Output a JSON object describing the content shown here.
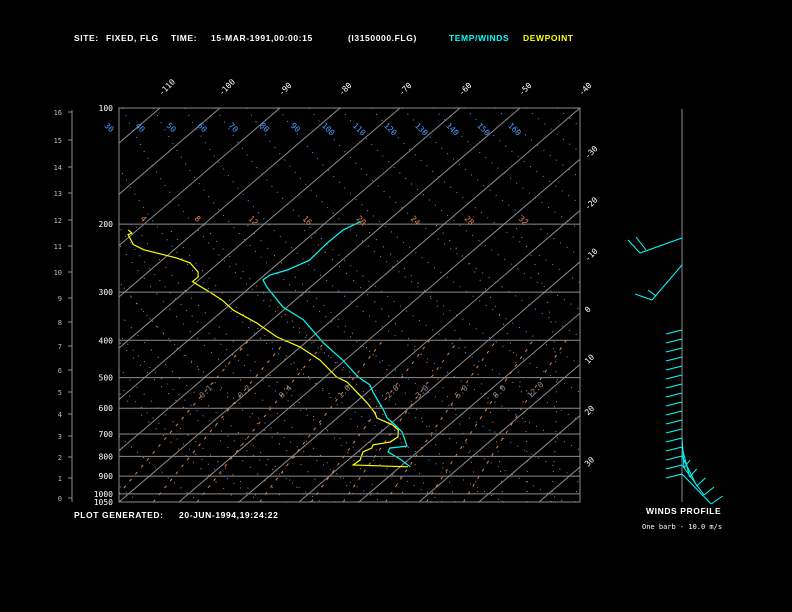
{
  "header": {
    "site_label": "SITE:",
    "site_value": "FIXED, FLG",
    "time_label": "TIME:",
    "time_value": "15-MAR-1991,00:00:15",
    "file": "(I3150000.FLG)",
    "legend_temp": "TEMP/WINDS",
    "legend_dewpoint": "DEWPOINT"
  },
  "footer": {
    "generated_label": "PLOT GENERATED:",
    "generated_value": "20-JUN-1994,19:24:22"
  },
  "winds": {
    "title": "WINDS PROFILE",
    "note": "One barb - 10.0 m/s"
  },
  "colors": {
    "temp": "#00ffff",
    "dewpoint": "#ffff00",
    "dry_adiabat": "#4a9cff",
    "moist": "#e8804a",
    "isotherm": "#8c8c8c",
    "text": "#ffffff"
  },
  "chart_data": {
    "type": "line",
    "subtype": "skew-T log-p",
    "y_scale": "log",
    "ylim_hpa": [
      1050,
      100
    ],
    "pressure_ticks": [
      100,
      200,
      300,
      400,
      500,
      600,
      700,
      800,
      900,
      1000,
      1050
    ],
    "height_ticks_km": [
      16,
      15,
      14,
      13,
      12,
      11,
      10,
      9,
      8,
      7,
      6,
      5,
      4,
      3,
      2,
      1,
      0
    ],
    "isotherm_labels_top": [
      -110,
      -100,
      -90,
      -80,
      -70,
      -60,
      -50,
      -40
    ],
    "isotherm_labels_right": [
      -30,
      -20,
      -10,
      0,
      10,
      20,
      30
    ],
    "dry_adiabat_labels": [
      30,
      40,
      50,
      60,
      70,
      80,
      90,
      100,
      110,
      120,
      130,
      140,
      150,
      160
    ],
    "moist_labels": [
      4,
      8,
      12,
      16,
      20,
      24,
      28,
      32
    ],
    "mixing_ratio_labels": [
      0.1,
      0.2,
      0.4,
      1.0,
      2.0,
      3.0,
      5.0,
      8.0,
      12.0
    ],
    "series": [
      {
        "name": "TEMP/WINDS",
        "pressure": [
          851,
          812,
          779,
          761,
          752,
          691,
          663,
          636,
          606,
          545,
          522,
          498,
          450,
          406,
          354,
          328,
          291,
          279,
          271,
          263,
          248,
          224,
          207,
          197
        ],
        "temperature": [
          1.7,
          -1.6,
          -4.9,
          -5.4,
          -2.9,
          -6.5,
          -9.0,
          -11.7,
          -13.9,
          -19.1,
          -21.0,
          -24.5,
          -30.4,
          -37.0,
          -44.8,
          -50.7,
          -57.3,
          -59.3,
          -59.1,
          -57.2,
          -55.4,
          -55.8,
          -55.7,
          -54.4
        ]
      },
      {
        "name": "DEWPOINT",
        "pressure": [
          851,
          842,
          817,
          779,
          761,
          747,
          734,
          712,
          683,
          663,
          636,
          617,
          581,
          545,
          513,
          498,
          450,
          416,
          392,
          361,
          334,
          315,
          300,
          282,
          274,
          266,
          252,
          245,
          240,
          233,
          226,
          213,
          211,
          207
        ],
        "temperature": [
          1.3,
          -8.2,
          -8.0,
          -9.1,
          -8.4,
          -8.8,
          -6.5,
          -6.2,
          -7.5,
          -9.4,
          -13.4,
          -14.7,
          -18.0,
          -21.8,
          -25.4,
          -28.1,
          -34.2,
          -40.1,
          -45.9,
          -51.9,
          -58.4,
          -62.1,
          -65.8,
          -70.7,
          -70.7,
          -71.7,
          -74.8,
          -77.9,
          -80.8,
          -85.1,
          -87.8,
          -90.6,
          -90.3,
          -91.5
        ]
      }
    ]
  }
}
